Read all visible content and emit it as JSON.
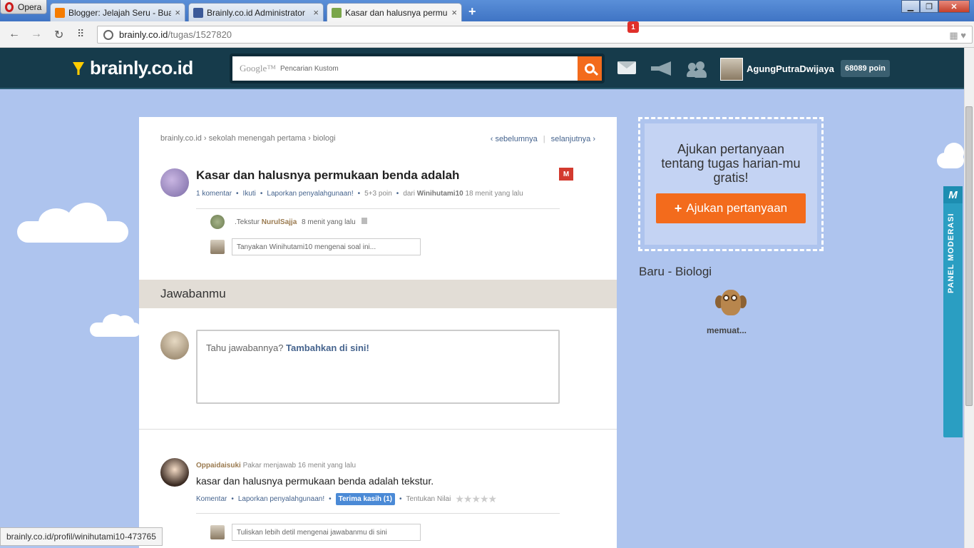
{
  "browser": {
    "opera_label": "Opera",
    "tabs": [
      {
        "title": "Blogger: Jelajah Seru - Buat",
        "color": "#f57c00"
      },
      {
        "title": "Brainly.co.id Administrator",
        "color": "#3b5998"
      },
      {
        "title": "Kasar dan halusnya permu",
        "color": "#7aa64a"
      }
    ],
    "url_host": "brainly.co.id",
    "url_path": "/tugas/1527820",
    "status_url": "brainly.co.id/profil/winihutami10-473765"
  },
  "header": {
    "logo_text": "brainly.co.id",
    "search_brand": "Google™",
    "search_placeholder": "Pencarian Kustom",
    "mail_count": "1",
    "username": "AgungPutraDwijaya",
    "points": "68089 poin"
  },
  "question": {
    "breadcrumb": "brainly.co.id  ›  sekolah menengah pertama  ›  biologi",
    "prev": "‹  sebelumnya",
    "next": "selanjutnya  ›",
    "title": "Kasar dan halusnya permukaan benda adalah",
    "mod_badge": "M",
    "meta": {
      "comments": "1 komentar",
      "follow": "Ikuti",
      "report": "Laporkan penyalahgunaan!",
      "points": "5+3 poin",
      "from": "dari",
      "author": "Winihutami10",
      "time": "18 menit yang lalu"
    },
    "comment": {
      "text": ".Tekstur",
      "user": "NurulSajja",
      "time": "8 menit yang lalu"
    },
    "ask_placeholder": "Tanyakan Winihutami10 mengenai soal ini..."
  },
  "answer_section": {
    "heading": "Jawabanmu",
    "prompt": "Tahu jawabannya?",
    "add_link": "Tambahkan di sini!"
  },
  "answer": {
    "user": "Oppaidaisuki",
    "role": "Pakar menjawab",
    "time": "16 menit yang lalu",
    "text": "kasar dan halusnya permukaan benda adalah tekstur.",
    "comment_link": "Komentar",
    "report": "Laporkan penyalahgunaan!",
    "thanks": "Terima kasih (1)",
    "rate_label": "Tentukan Nilai",
    "rating": 0,
    "stars": "★★★★★",
    "detail_placeholder": "Tuliskan lebih detil mengenai jawabanmu di sini"
  },
  "sidebar": {
    "ask_text": "Ajukan pertanyaan tentang tugas harian-mu gratis!",
    "ask_button": "Ajukan pertanyaan",
    "new_heading": "Baru - Biologi",
    "loading": "memuat...",
    "mod_panel_logo": "M",
    "mod_panel_label": "PANEL MODERASI"
  },
  "colors": {
    "brand_header": "#163b4b",
    "accent_orange": "#f36b1c",
    "page_bg": "#aec4ee",
    "link_blue": "#46648e"
  }
}
